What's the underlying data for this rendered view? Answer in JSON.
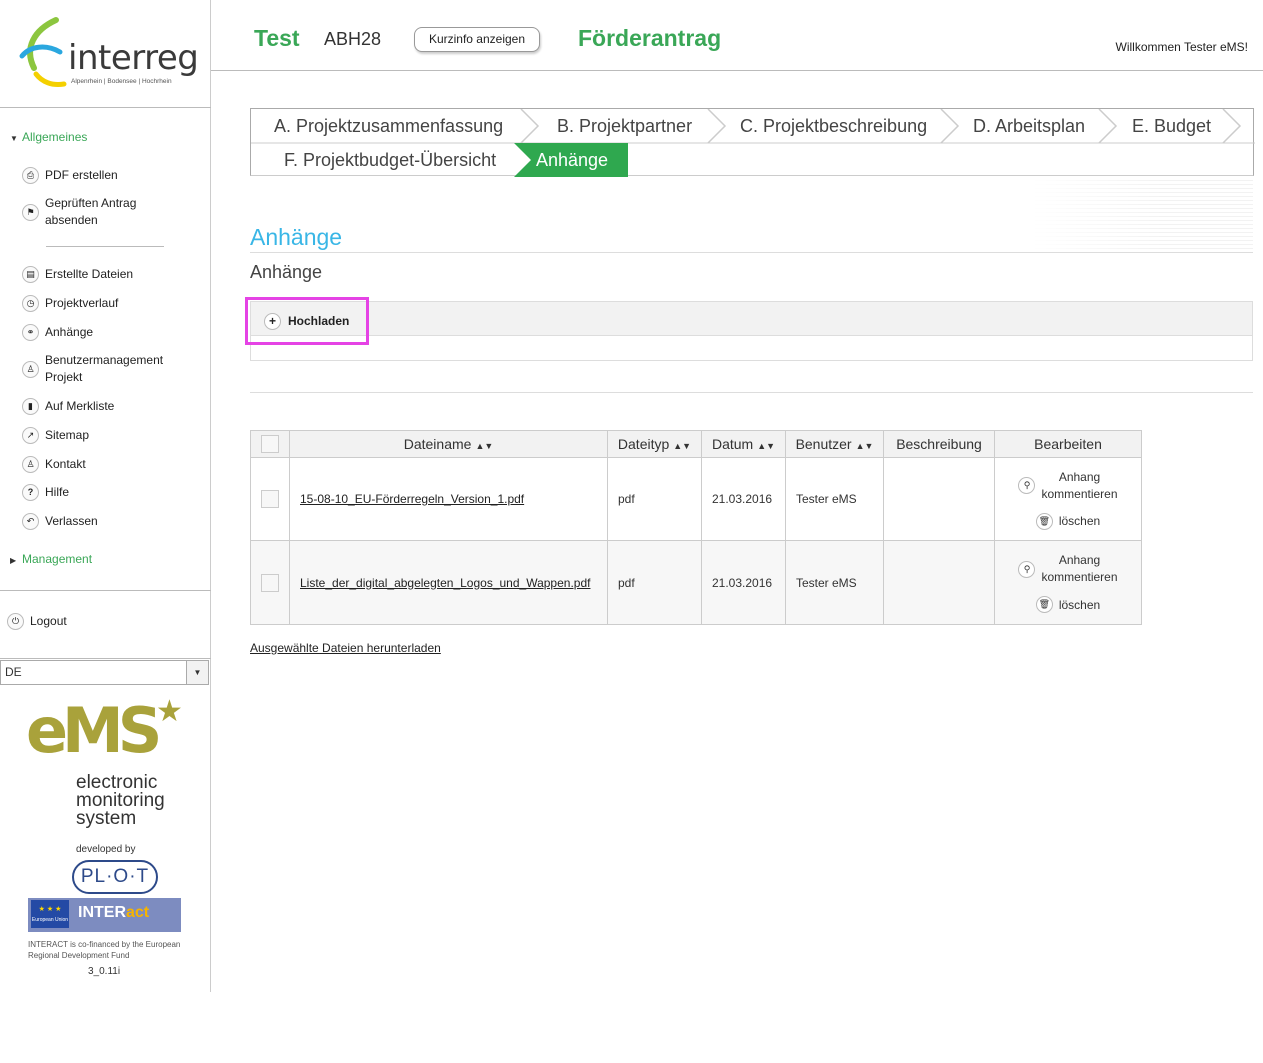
{
  "logo": {
    "word": "interreg",
    "sub": "Alpenrhein | Bodensee | Hochrhein"
  },
  "header": {
    "project_name": "Test",
    "project_code": "ABH28",
    "kurzinfo_label": "Kurzinfo anzeigen",
    "doc_title": "Förderantrag",
    "welcome": "Willkommen Tester eMS!"
  },
  "sidebar": {
    "section_general": "Allgemeines",
    "items_top": [
      {
        "label": "PDF erstellen",
        "icon": "printer-icon"
      },
      {
        "label": "Geprüften Antrag absenden",
        "icon": "flag-icon"
      }
    ],
    "items": [
      {
        "label": "Erstellte Dateien",
        "icon": "archive-icon"
      },
      {
        "label": "Projektverlauf",
        "icon": "history-icon"
      },
      {
        "label": "Anhänge",
        "icon": "link-icon"
      },
      {
        "label": "Benutzermanagement Projekt",
        "icon": "user-icon"
      },
      {
        "label": "Auf Merkliste",
        "icon": "bookmark-icon"
      },
      {
        "label": "Sitemap",
        "icon": "external-icon"
      },
      {
        "label": "Kontakt",
        "icon": "person-icon"
      },
      {
        "label": "Hilfe",
        "icon": "help-icon"
      },
      {
        "label": "Verlassen",
        "icon": "back-icon"
      }
    ],
    "section_management": "Management",
    "logout": "Logout",
    "language": "DE"
  },
  "ems": {
    "big": "eMS",
    "line1": "electronic",
    "line2": "monitoring",
    "line3": "system",
    "developed": "developed by",
    "plot": "PL·O·T",
    "eu": "European Union",
    "interact_a": "INTER",
    "interact_b": "act",
    "financed": "INTERACT is co-financed by the European Regional Development Fund",
    "version": "3_0.11i"
  },
  "tabs": [
    {
      "label": "A. Projektzusammenfassung"
    },
    {
      "label": "B. Projektpartner"
    },
    {
      "label": "C. Projektbeschreibung"
    },
    {
      "label": "D. Arbeitsplan"
    },
    {
      "label": "E. Budget"
    },
    {
      "label": "F. Projektbudget-Übersicht"
    },
    {
      "label": "Anhänge",
      "active": true
    }
  ],
  "main": {
    "section_title": "Anhänge",
    "sub_title": "Anhänge",
    "upload_label": "Hochladen",
    "download_selected": "Ausgewählte Dateien herunterladen"
  },
  "table": {
    "headers": {
      "filename": "Dateiname",
      "filetype": "Dateityp",
      "date": "Datum",
      "user": "Benutzer",
      "description": "Beschreibung",
      "edit": "Bearbeiten"
    },
    "rows": [
      {
        "filename": "15-08-10_EU-Förderregeln_Version_1.pdf",
        "filetype": "pdf",
        "date": "21.03.2016",
        "user": "Tester eMS",
        "description": "",
        "comment_1": "Anhang",
        "comment_2": "kommentieren",
        "delete": "löschen"
      },
      {
        "filename": "Liste_der_digital_abgelegten_Logos_und_Wappen.pdf",
        "filetype": "pdf",
        "date": "21.03.2016",
        "user": "Tester eMS",
        "description": "",
        "comment_1": "Anhang",
        "comment_2": "kommentieren",
        "delete": "löschen"
      }
    ]
  },
  "colors": {
    "green": "#3aa757",
    "blue": "#39b6e6",
    "highlight": "#e543e5",
    "ems_olive": "#a9a23b"
  }
}
